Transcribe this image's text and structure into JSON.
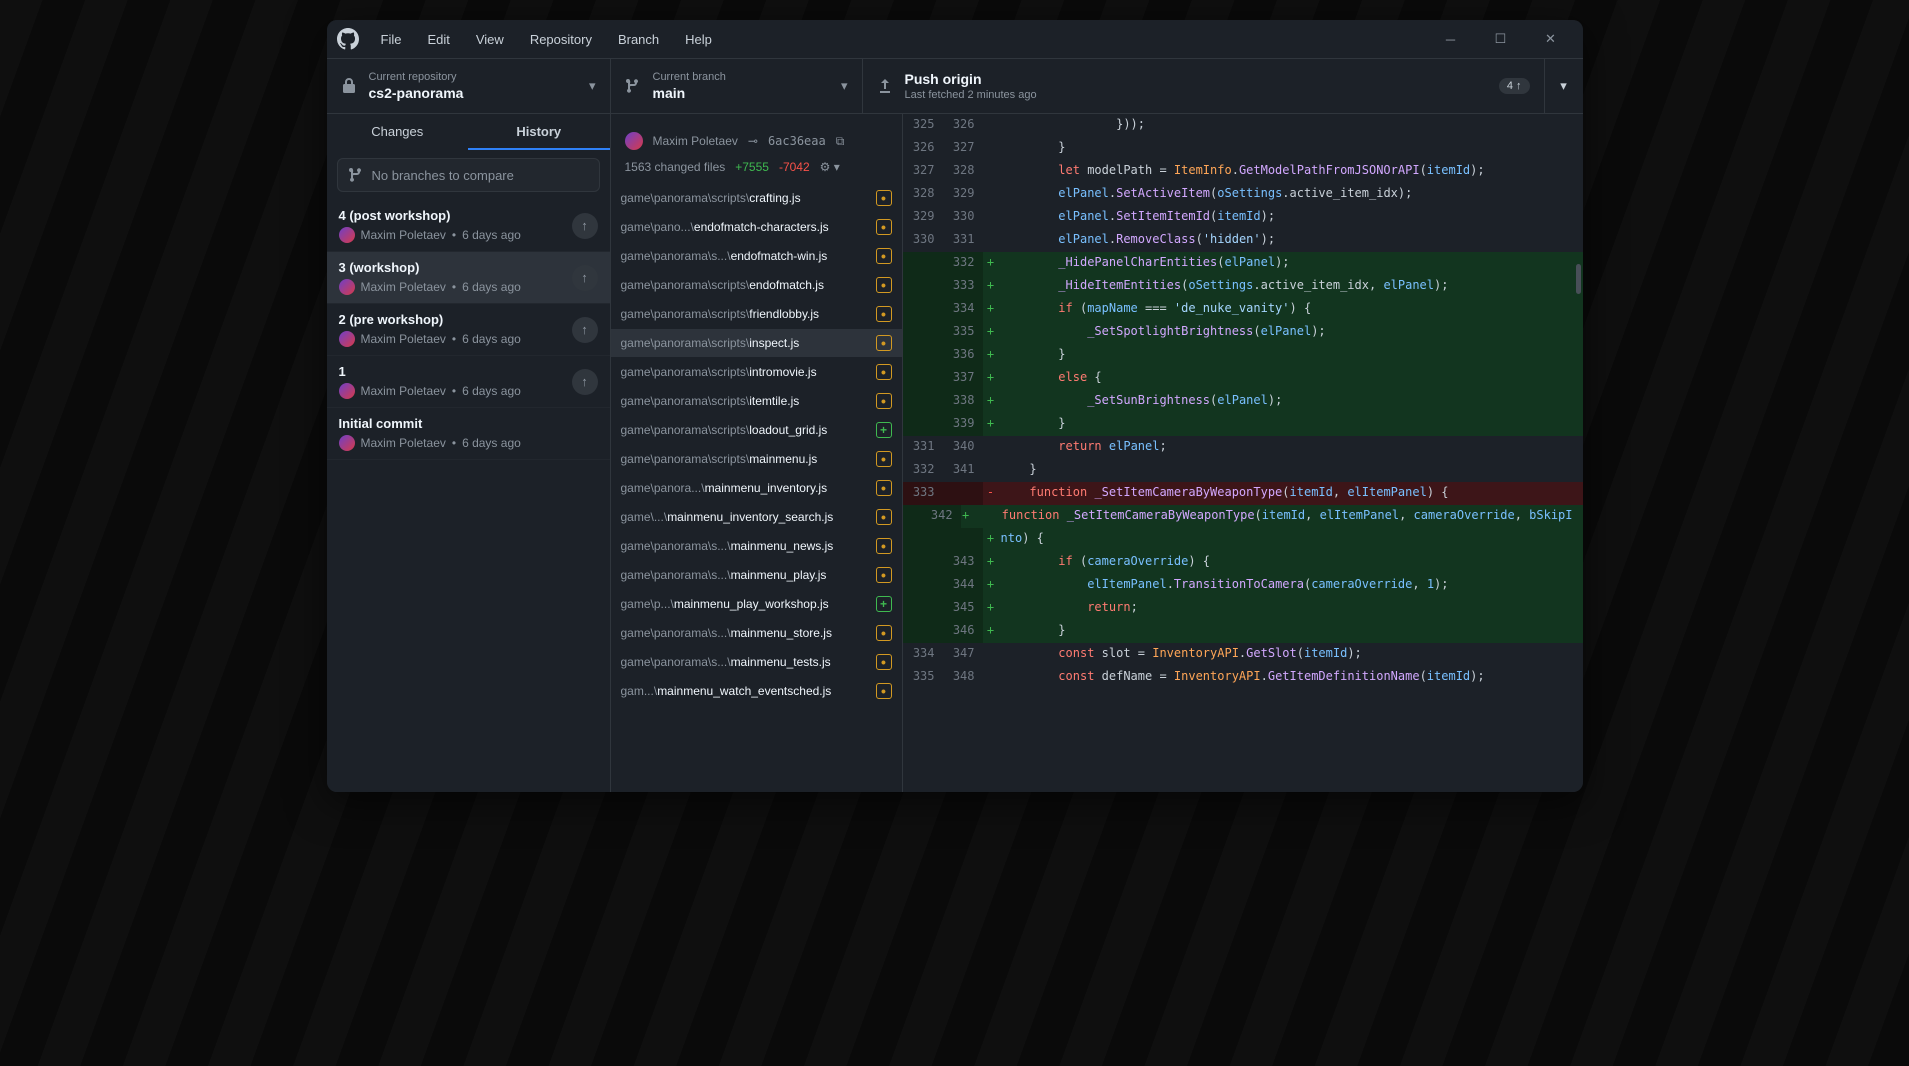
{
  "menus": [
    "File",
    "Edit",
    "View",
    "Repository",
    "Branch",
    "Help"
  ],
  "repo": {
    "label": "Current repository",
    "name": "cs2-panorama"
  },
  "branch": {
    "label": "Current branch",
    "name": "main"
  },
  "push": {
    "title": "Push origin",
    "sub": "Last fetched 2 minutes ago",
    "count": "4 ↑"
  },
  "tabs": {
    "changes": "Changes",
    "history": "History"
  },
  "compare_placeholder": "No branches to compare",
  "commits": [
    {
      "title": "4 (post workshop)",
      "author": "Maxim Poletaev",
      "time": "6 days ago",
      "selected": false,
      "push": true
    },
    {
      "title": "3 (workshop)",
      "author": "Maxim Poletaev",
      "time": "6 days ago",
      "selected": true,
      "push": true
    },
    {
      "title": "2 (pre workshop)",
      "author": "Maxim Poletaev",
      "time": "6 days ago",
      "selected": false,
      "push": true
    },
    {
      "title": "1",
      "author": "Maxim Poletaev",
      "time": "6 days ago",
      "selected": false,
      "push": true
    },
    {
      "title": "Initial commit",
      "author": "Maxim Poletaev",
      "time": "6 days ago",
      "selected": false,
      "push": false
    }
  ],
  "commit_detail": {
    "title": "3 (workshop)",
    "author": "Maxim Poletaev",
    "sha": "6ac36eaa",
    "files_changed": "1563 changed files",
    "adds": "+7555",
    "dels": "-7042"
  },
  "files": [
    {
      "prefix": "game\\panorama\\scripts\\",
      "name": "crafting.js",
      "status": "mod",
      "selected": false
    },
    {
      "prefix": "game\\pano...\\",
      "name": "endofmatch-characters.js",
      "status": "mod",
      "selected": false
    },
    {
      "prefix": "game\\panorama\\s...\\",
      "name": "endofmatch-win.js",
      "status": "mod",
      "selected": false
    },
    {
      "prefix": "game\\panorama\\scripts\\",
      "name": "endofmatch.js",
      "status": "mod",
      "selected": false
    },
    {
      "prefix": "game\\panorama\\scripts\\",
      "name": "friendlobby.js",
      "status": "mod",
      "selected": false
    },
    {
      "prefix": "game\\panorama\\scripts\\",
      "name": "inspect.js",
      "status": "mod",
      "selected": true
    },
    {
      "prefix": "game\\panorama\\scripts\\",
      "name": "intromovie.js",
      "status": "mod",
      "selected": false
    },
    {
      "prefix": "game\\panorama\\scripts\\",
      "name": "itemtile.js",
      "status": "mod",
      "selected": false
    },
    {
      "prefix": "game\\panorama\\scripts\\",
      "name": "loadout_grid.js",
      "status": "add",
      "selected": false
    },
    {
      "prefix": "game\\panorama\\scripts\\",
      "name": "mainmenu.js",
      "status": "mod",
      "selected": false
    },
    {
      "prefix": "game\\panora...\\",
      "name": "mainmenu_inventory.js",
      "status": "mod",
      "selected": false
    },
    {
      "prefix": "game\\...\\",
      "name": "mainmenu_inventory_search.js",
      "status": "mod",
      "selected": false
    },
    {
      "prefix": "game\\panorama\\s...\\",
      "name": "mainmenu_news.js",
      "status": "mod",
      "selected": false
    },
    {
      "prefix": "game\\panorama\\s...\\",
      "name": "mainmenu_play.js",
      "status": "mod",
      "selected": false
    },
    {
      "prefix": "game\\p...\\",
      "name": "mainmenu_play_workshop.js",
      "status": "add",
      "selected": false
    },
    {
      "prefix": "game\\panorama\\s...\\",
      "name": "mainmenu_store.js",
      "status": "mod",
      "selected": false
    },
    {
      "prefix": "game\\panorama\\s...\\",
      "name": "mainmenu_tests.js",
      "status": "mod",
      "selected": false
    },
    {
      "prefix": "gam...\\",
      "name": "mainmenu_watch_eventsched.js",
      "status": "mod",
      "selected": false
    }
  ],
  "diff": [
    {
      "old": "325",
      "new": "326",
      "type": "ctx",
      "tokens": [
        [
          "plain",
          "                }));"
        ]
      ]
    },
    {
      "old": "326",
      "new": "327",
      "type": "ctx",
      "tokens": [
        [
          "plain",
          "        }"
        ]
      ]
    },
    {
      "old": "327",
      "new": "328",
      "type": "ctx",
      "tokens": [
        [
          "plain",
          "        "
        ],
        [
          "kw",
          "let"
        ],
        [
          "plain",
          " modelPath = "
        ],
        [
          "type",
          "ItemInfo"
        ],
        [
          "plain",
          "."
        ],
        [
          "fn",
          "GetModelPathFromJSONOrAPI"
        ],
        [
          "plain",
          "("
        ],
        [
          "var",
          "itemId"
        ],
        [
          "plain",
          ");"
        ]
      ]
    },
    {
      "old": "328",
      "new": "329",
      "type": "ctx",
      "tokens": [
        [
          "plain",
          "        "
        ],
        [
          "var",
          "elPanel"
        ],
        [
          "plain",
          "."
        ],
        [
          "fn",
          "SetActiveItem"
        ],
        [
          "plain",
          "("
        ],
        [
          "var",
          "oSettings"
        ],
        [
          "plain",
          ".active_item_idx);"
        ]
      ]
    },
    {
      "old": "329",
      "new": "330",
      "type": "ctx",
      "tokens": [
        [
          "plain",
          "        "
        ],
        [
          "var",
          "elPanel"
        ],
        [
          "plain",
          "."
        ],
        [
          "fn",
          "SetItemItemId"
        ],
        [
          "plain",
          "("
        ],
        [
          "var",
          "itemId"
        ],
        [
          "plain",
          ");"
        ]
      ]
    },
    {
      "old": "330",
      "new": "331",
      "type": "ctx",
      "tokens": [
        [
          "plain",
          "        "
        ],
        [
          "var",
          "elPanel"
        ],
        [
          "plain",
          "."
        ],
        [
          "fn",
          "RemoveClass"
        ],
        [
          "plain",
          "("
        ],
        [
          "str",
          "'hidden'"
        ],
        [
          "plain",
          ");"
        ]
      ]
    },
    {
      "old": "",
      "new": "332",
      "type": "add",
      "tokens": [
        [
          "plain",
          "        "
        ],
        [
          "fn",
          "_HidePanelCharEntities"
        ],
        [
          "plain",
          "("
        ],
        [
          "var",
          "elPanel"
        ],
        [
          "plain",
          ");"
        ]
      ]
    },
    {
      "old": "",
      "new": "333",
      "type": "add",
      "tokens": [
        [
          "plain",
          "        "
        ],
        [
          "fn",
          "_HideItemEntities"
        ],
        [
          "plain",
          "("
        ],
        [
          "var",
          "oSettings"
        ],
        [
          "plain",
          ".active_item_idx, "
        ],
        [
          "var",
          "elPanel"
        ],
        [
          "plain",
          ");"
        ]
      ]
    },
    {
      "old": "",
      "new": "334",
      "type": "add",
      "tokens": [
        [
          "plain",
          "        "
        ],
        [
          "kw",
          "if"
        ],
        [
          "plain",
          " ("
        ],
        [
          "var",
          "mapName"
        ],
        [
          "plain",
          " === "
        ],
        [
          "str",
          "'de_nuke_vanity'"
        ],
        [
          "plain",
          ") {"
        ]
      ]
    },
    {
      "old": "",
      "new": "335",
      "type": "add",
      "tokens": [
        [
          "plain",
          "            "
        ],
        [
          "fn",
          "_SetSpotlightBrightness"
        ],
        [
          "plain",
          "("
        ],
        [
          "var",
          "elPanel"
        ],
        [
          "plain",
          ");"
        ]
      ]
    },
    {
      "old": "",
      "new": "336",
      "type": "add",
      "tokens": [
        [
          "plain",
          "        }"
        ]
      ]
    },
    {
      "old": "",
      "new": "337",
      "type": "add",
      "tokens": [
        [
          "plain",
          "        "
        ],
        [
          "kw",
          "else"
        ],
        [
          "plain",
          " {"
        ]
      ]
    },
    {
      "old": "",
      "new": "338",
      "type": "add",
      "tokens": [
        [
          "plain",
          "            "
        ],
        [
          "fn",
          "_SetSunBrightness"
        ],
        [
          "plain",
          "("
        ],
        [
          "var",
          "elPanel"
        ],
        [
          "plain",
          ");"
        ]
      ]
    },
    {
      "old": "",
      "new": "339",
      "type": "add",
      "tokens": [
        [
          "plain",
          "        }"
        ]
      ]
    },
    {
      "old": "331",
      "new": "340",
      "type": "ctx",
      "tokens": [
        [
          "plain",
          "        "
        ],
        [
          "kw",
          "return"
        ],
        [
          "plain",
          " "
        ],
        [
          "var",
          "elPanel"
        ],
        [
          "plain",
          ";"
        ]
      ]
    },
    {
      "old": "332",
      "new": "341",
      "type": "ctx",
      "tokens": [
        [
          "plain",
          "    }"
        ]
      ]
    },
    {
      "old": "333",
      "new": "",
      "type": "del",
      "tokens": [
        [
          "plain",
          "    "
        ],
        [
          "kw",
          "function"
        ],
        [
          "plain",
          " "
        ],
        [
          "fn",
          "_SetItemCameraByWeaponType"
        ],
        [
          "plain",
          "("
        ],
        [
          "var",
          "itemId"
        ],
        [
          "plain",
          ", "
        ],
        [
          "var",
          "elItemPanel"
        ],
        [
          "plain",
          ") {"
        ]
      ]
    },
    {
      "old": "",
      "new": "342",
      "type": "add",
      "tokens": [
        [
          "plain",
          "    "
        ],
        [
          "kw",
          "function"
        ],
        [
          "plain",
          " "
        ],
        [
          "fn",
          "_SetItemCameraByWeaponType"
        ],
        [
          "plain",
          "("
        ],
        [
          "var",
          "itemId"
        ],
        [
          "plain",
          ", "
        ],
        [
          "var",
          "elItemPanel"
        ],
        [
          "plain",
          ", "
        ],
        [
          "var",
          "cameraOverride"
        ],
        [
          "plain",
          ", "
        ],
        [
          "var",
          "bSkipI"
        ]
      ]
    },
    {
      "old": "",
      "new": "",
      "type": "add",
      "tokens": [
        [
          "var",
          "nto"
        ],
        [
          "plain",
          ") {"
        ]
      ]
    },
    {
      "old": "",
      "new": "343",
      "type": "add",
      "tokens": [
        [
          "plain",
          "        "
        ],
        [
          "kw",
          "if"
        ],
        [
          "plain",
          " ("
        ],
        [
          "var",
          "cameraOverride"
        ],
        [
          "plain",
          ") {"
        ]
      ]
    },
    {
      "old": "",
      "new": "344",
      "type": "add",
      "tokens": [
        [
          "plain",
          "            "
        ],
        [
          "var",
          "elItemPanel"
        ],
        [
          "plain",
          "."
        ],
        [
          "fn",
          "TransitionToCamera"
        ],
        [
          "plain",
          "("
        ],
        [
          "var",
          "cameraOverride"
        ],
        [
          "plain",
          ", "
        ],
        [
          "var",
          "1"
        ],
        [
          "plain",
          ");"
        ]
      ]
    },
    {
      "old": "",
      "new": "345",
      "type": "add",
      "tokens": [
        [
          "plain",
          "            "
        ],
        [
          "kw",
          "return"
        ],
        [
          "plain",
          ";"
        ]
      ]
    },
    {
      "old": "",
      "new": "346",
      "type": "add",
      "tokens": [
        [
          "plain",
          "        }"
        ]
      ]
    },
    {
      "old": "334",
      "new": "347",
      "type": "ctx",
      "tokens": [
        [
          "plain",
          "        "
        ],
        [
          "kw",
          "const"
        ],
        [
          "plain",
          " slot = "
        ],
        [
          "type",
          "InventoryAPI"
        ],
        [
          "plain",
          "."
        ],
        [
          "fn",
          "GetSlot"
        ],
        [
          "plain",
          "("
        ],
        [
          "var",
          "itemId"
        ],
        [
          "plain",
          ");"
        ]
      ]
    },
    {
      "old": "335",
      "new": "348",
      "type": "ctx",
      "tokens": [
        [
          "plain",
          "        "
        ],
        [
          "kw",
          "const"
        ],
        [
          "plain",
          " defName = "
        ],
        [
          "type",
          "InventoryAPI"
        ],
        [
          "plain",
          "."
        ],
        [
          "fn",
          "GetItemDefinitionName"
        ],
        [
          "plain",
          "("
        ],
        [
          "var",
          "itemId"
        ],
        [
          "plain",
          ");"
        ]
      ]
    }
  ]
}
